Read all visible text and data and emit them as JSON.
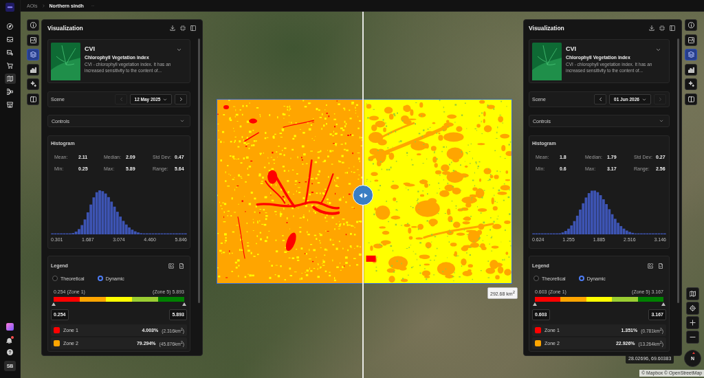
{
  "top_bar": {
    "breadcrumb": [
      {
        "label": "AOIs",
        "current": false
      },
      {
        "label": "Northern sindh",
        "current": true
      }
    ]
  },
  "app_sidebar": {
    "nav_items": [
      {
        "selected": false
      },
      {
        "selected": false
      },
      {
        "selected": false
      },
      {
        "selected": false
      },
      {
        "selected": true
      },
      {
        "selected": false
      },
      {
        "selected": false
      }
    ],
    "notifications": {
      "unread": true
    },
    "user_initials": "SB"
  },
  "panels": [
    {
      "toolbar": [
        {
          "selected": false
        },
        {
          "selected": false
        },
        {
          "selected": true
        },
        {
          "selected": false
        },
        {
          "selected": false
        },
        {
          "selected": false
        }
      ],
      "title": "Visualization",
      "index": {
        "name": "CVI",
        "full_name": "Chlorophyll Vegetation index",
        "description": "CVI - chlorophyll vegetation index. It has an increased sensitivity to the content of..."
      },
      "scene": {
        "label": "Scene",
        "date": "12 May 2025",
        "prev_disabled": true,
        "next_disabled": false
      },
      "controls": {
        "label": "Controls",
        "expanded": false
      },
      "histogram": {
        "title": "Histogram",
        "stats": [
          {
            "label": "Mean:",
            "value": "2.11"
          },
          {
            "label": "Median:",
            "value": "2.09"
          },
          {
            "label": "Std Dev:",
            "value": "0.47"
          },
          {
            "label": "Min:",
            "value": "0.25"
          },
          {
            "label": "Max:",
            "value": "5.89"
          },
          {
            "label": "Range:",
            "value": "5.64"
          }
        ],
        "axis_labels": [
          "0.301",
          "1.687",
          "3.074",
          "4.460",
          "5.846"
        ]
      },
      "legend": {
        "title": "Legend",
        "modes": [
          {
            "label": "Theoretical",
            "selected": false
          },
          {
            "label": "Dynamic",
            "selected": true
          }
        ],
        "min_label": "0.254 (Zone 1)",
        "max_label": "(Zone 5) 5.893",
        "scale": [
          {
            "color": "#ff0000"
          },
          {
            "color": "#ffa500"
          },
          {
            "color": "#ffff00"
          },
          {
            "color": "#9acd32"
          },
          {
            "color": "#008000"
          }
        ],
        "min_value": "0.254",
        "max_value": "5.893",
        "zones": [
          {
            "name": "Zone 1",
            "color": "#ff0000",
            "percent": "4.003%",
            "area": "(2.316km$^{2}$)"
          },
          {
            "name": "Zone 2",
            "color": "#ffa500",
            "percent": "79.294%",
            "area": "(45.876km$^{2}$)"
          }
        ]
      }
    },
    {
      "toolbar": [
        {
          "selected": false
        },
        {
          "selected": false
        },
        {
          "selected": true
        },
        {
          "selected": false
        },
        {
          "selected": false
        },
        {
          "selected": false
        }
      ],
      "title": "Visualization",
      "index": {
        "name": "CVI",
        "full_name": "Chlorophyll Vegetation index",
        "description": "CVI - chlorophyll vegetation index. It has an increased sensitivity to the content of..."
      },
      "scene": {
        "label": "Scene",
        "date": "01 Jun 2026",
        "prev_disabled": false,
        "next_disabled": true
      },
      "controls": {
        "label": "Controls",
        "expanded": false
      },
      "histogram": {
        "title": "Histogram",
        "stats": [
          {
            "label": "Mean:",
            "value": "1.8"
          },
          {
            "label": "Median:",
            "value": "1.79"
          },
          {
            "label": "Std Dev:",
            "value": "0.27"
          },
          {
            "label": "Min:",
            "value": "0.6"
          },
          {
            "label": "Max:",
            "value": "3.17"
          },
          {
            "label": "Range:",
            "value": "2.56"
          }
        ],
        "axis_labels": [
          "0.624",
          "1.255",
          "1.885",
          "2.516",
          "3.146"
        ]
      },
      "legend": {
        "title": "Legend",
        "modes": [
          {
            "label": "Theoretical",
            "selected": false
          },
          {
            "label": "Dynamic",
            "selected": true
          }
        ],
        "min_label": "0.603 (Zone 1)",
        "max_label": "(Zone 5) 3.167",
        "scale": [
          {
            "color": "#ff0000"
          },
          {
            "color": "#ffa500"
          },
          {
            "color": "#ffff00"
          },
          {
            "color": "#9acd32"
          },
          {
            "color": "#008000"
          }
        ],
        "min_value": "0.603",
        "max_value": "3.167",
        "zones": [
          {
            "name": "Zone 1",
            "color": "#ff0000",
            "percent": "1.351%",
            "area": "(0.781km$^{2}$)"
          },
          {
            "name": "Zone 2",
            "color": "#ffa500",
            "percent": "22.926%",
            "area": "(13.264km$^{2}$)"
          }
        ]
      }
    }
  ],
  "map": {
    "area_label": "292.68 km$^{2}$",
    "coordinates": "28.02696, 69.60383",
    "compass_label": "N",
    "attribution": "© Mapbox © OpenStreetMap"
  }
}
